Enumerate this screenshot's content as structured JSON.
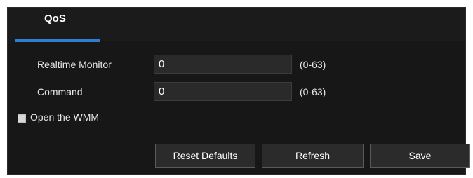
{
  "tab": {
    "label": "QoS"
  },
  "form": {
    "realtime_monitor": {
      "label": "Realtime Monitor",
      "value": "0",
      "range": "(0-63)"
    },
    "command": {
      "label": "Command",
      "value": "0",
      "range": "(0-63)"
    },
    "wmm": {
      "label": "Open the WMM",
      "checked": false
    }
  },
  "buttons": {
    "reset_defaults": "Reset Defaults",
    "refresh": "Refresh",
    "save": "Save"
  },
  "colors": {
    "panel_background": "#171717",
    "tab_accent": "#2f7fd1",
    "field_background": "#2a2a2a",
    "button_border": "#5a5a5a"
  }
}
